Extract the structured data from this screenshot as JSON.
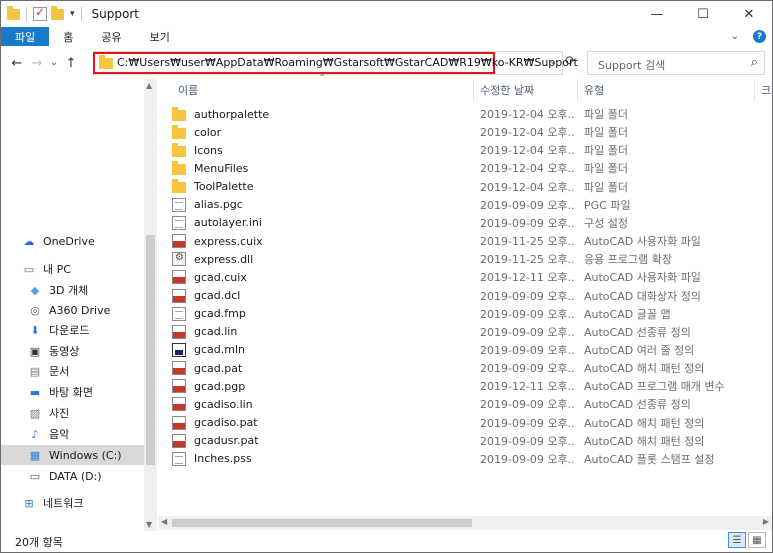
{
  "window": {
    "title": "Support",
    "controls": {
      "minimize": "—",
      "maximize": "☐",
      "close": "✕"
    }
  },
  "ribbon": {
    "tabs": [
      "파일",
      "홈",
      "공유",
      "보기"
    ],
    "collapse_glyph": "⌄",
    "help_glyph": "?"
  },
  "nav": {
    "back_glyph": "←",
    "forward_glyph": "→",
    "recent_glyph": "⌄",
    "up_glyph": "↑"
  },
  "address": {
    "path": "C:₩Users₩user₩AppData₩Roaming₩Gstarsoft₩GstarCAD₩R19₩ko-KR₩Support",
    "dropdown_glyph": "⌄",
    "refresh_glyph": "⟳"
  },
  "search": {
    "placeholder": "Support 검색",
    "icon_glyph": "⌕"
  },
  "sidebar": {
    "items": [
      {
        "label": "OneDrive",
        "icon": "cloud-icon",
        "glyph": "☁",
        "color": "#1b6fd1"
      },
      {
        "label": "내 PC",
        "icon": "pc-icon",
        "glyph": "▭",
        "color": "#3a7cc2"
      },
      {
        "label": "3D 개체",
        "icon": "cube-icon",
        "glyph": "◆",
        "color": "#4aa3df"
      },
      {
        "label": "A360 Drive",
        "icon": "a360-icon",
        "glyph": "◎",
        "color": "#555555"
      },
      {
        "label": "다운로드",
        "icon": "download-icon",
        "glyph": "⬇",
        "color": "#2b7bd3"
      },
      {
        "label": "동영상",
        "icon": "video-icon",
        "glyph": "▣",
        "color": "#333333"
      },
      {
        "label": "문서",
        "icon": "document-icon",
        "glyph": "▤",
        "color": "#6b7b8c"
      },
      {
        "label": "바탕 화면",
        "icon": "desktop-icon",
        "glyph": "▬",
        "color": "#2b7bd3"
      },
      {
        "label": "사진",
        "icon": "picture-icon",
        "glyph": "▨",
        "color": "#6b7b8c"
      },
      {
        "label": "음악",
        "icon": "music-icon",
        "glyph": "♪",
        "color": "#2b7bd3"
      },
      {
        "label": "Windows  (C:)",
        "icon": "windows-drive-icon",
        "glyph": "▦",
        "color": "#2b7bd3"
      },
      {
        "label": "DATA (D:)",
        "icon": "drive-icon",
        "glyph": "▭",
        "color": "#555555"
      },
      {
        "label": "네트워크",
        "icon": "network-icon",
        "glyph": "⊞",
        "color": "#2b7bd3"
      }
    ]
  },
  "columns": {
    "name": "이름",
    "date": "수정한 날짜",
    "type": "유형",
    "size": "크기"
  },
  "files": [
    {
      "name": "authorpalette",
      "date": "2019-12-04 오후...",
      "type": "파일 폴더",
      "icon": "folder"
    },
    {
      "name": "color",
      "date": "2019-12-04 오후...",
      "type": "파일 폴더",
      "icon": "folder"
    },
    {
      "name": "Icons",
      "date": "2019-12-04 오후...",
      "type": "파일 폴더",
      "icon": "folder"
    },
    {
      "name": "MenuFiles",
      "date": "2019-12-04 오후...",
      "type": "파일 폴더",
      "icon": "folder"
    },
    {
      "name": "ToolPalette",
      "date": "2019-12-04 오후...",
      "type": "파일 폴더",
      "icon": "folder"
    },
    {
      "name": "alias.pgc",
      "date": "2019-09-09 오후...",
      "type": "PGC 파일",
      "icon": "doc"
    },
    {
      "name": "autolayer.ini",
      "date": "2019-09-09 오후...",
      "type": "구성 설정",
      "icon": "doc"
    },
    {
      "name": "express.cuix",
      "date": "2019-11-25 오후...",
      "type": "AutoCAD 사용자화 파일",
      "icon": "cad"
    },
    {
      "name": "express.dll",
      "date": "2019-11-25 오후...",
      "type": "응용 프로그램 확장",
      "icon": "dll"
    },
    {
      "name": "gcad.cuix",
      "date": "2019-12-11 오후...",
      "type": "AutoCAD 사용자화 파일",
      "icon": "cad"
    },
    {
      "name": "gcad.dcl",
      "date": "2019-09-09 오후...",
      "type": "AutoCAD 대화상자 정의",
      "icon": "cad"
    },
    {
      "name": "gcad.fmp",
      "date": "2019-09-09 오후...",
      "type": "AutoCAD 글꼴 맵",
      "icon": "doc"
    },
    {
      "name": "gcad.lin",
      "date": "2019-09-09 오후...",
      "type": "AutoCAD 선종류 정의",
      "icon": "cad"
    },
    {
      "name": "gcad.mln",
      "date": "2019-09-09 오후...",
      "type": "AutoCAD 여러 줄 정의",
      "icon": "mln"
    },
    {
      "name": "gcad.pat",
      "date": "2019-09-09 오후...",
      "type": "AutoCAD 해치 패턴 정의",
      "icon": "cad"
    },
    {
      "name": "gcad.pgp",
      "date": "2019-12-11 오후...",
      "type": "AutoCAD 프로그램 매개 변수",
      "icon": "cad"
    },
    {
      "name": "gcadiso.lin",
      "date": "2019-09-09 오후...",
      "type": "AutoCAD 선종류 정의",
      "icon": "cad"
    },
    {
      "name": "gcadiso.pat",
      "date": "2019-09-09 오후...",
      "type": "AutoCAD 해치 패턴 정의",
      "icon": "cad"
    },
    {
      "name": "gcadusr.pat",
      "date": "2019-09-09 오후...",
      "type": "AutoCAD 해치 패턴 정의",
      "icon": "cad"
    },
    {
      "name": "Inches.pss",
      "date": "2019-09-09 오후...",
      "type": "AutoCAD 플롯 스탬프 설정",
      "icon": "doc"
    }
  ],
  "status": {
    "item_count": "20개 항목"
  },
  "colors": {
    "accent": "#1979ca",
    "highlight_box": "#e0151b",
    "folder": "#f5c542"
  }
}
